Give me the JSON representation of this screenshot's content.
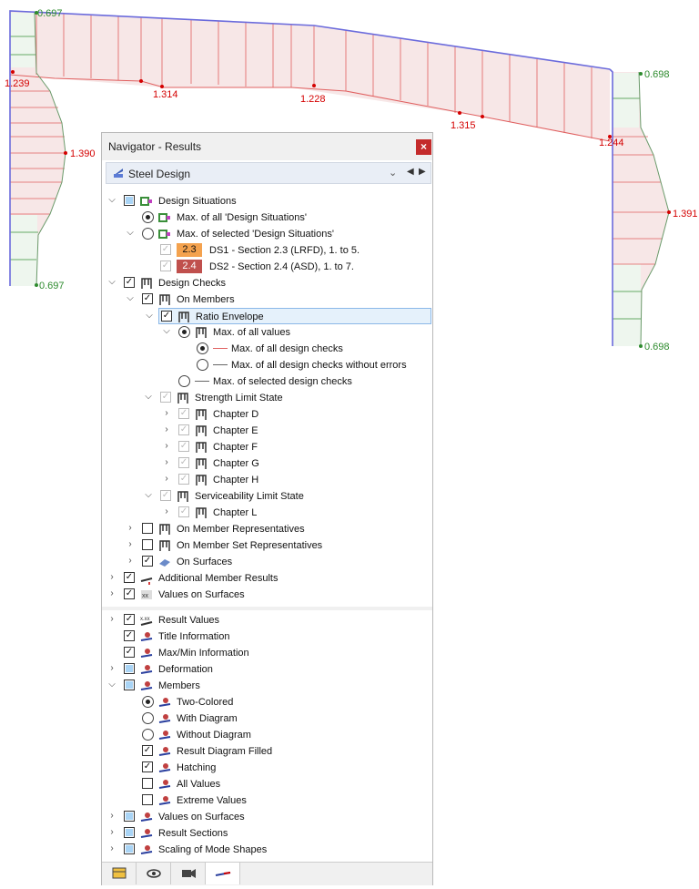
{
  "diagram": {
    "labels": {
      "left_top": "0.697",
      "left_bottom": "0.697",
      "right_top": "0.698",
      "right_bottom": "0.698",
      "v1": "1.239",
      "v2": "1.314",
      "v3": "1.228",
      "v4": "1.315",
      "v5": "1.244",
      "left_max": "1.390",
      "right_max": "1.391"
    },
    "colors": {
      "member": "#6b6bdc",
      "diagram_line": "#e06060",
      "diagram_fill": "#f7e7e7",
      "min_label": "#2e8b2e",
      "max_label": "#d40000"
    }
  },
  "navigator": {
    "title": "Navigator - Results",
    "close_icon": "close-icon",
    "module": "Steel Design",
    "items": [
      {
        "label": "Design Situations"
      },
      {
        "label": "Max. of all 'Design Situations'"
      },
      {
        "label": "Max. of selected 'Design Situations'"
      },
      {
        "badge": "2.3",
        "badge_color": "#f4a24e",
        "label": "DS1 - Section 2.3 (LRFD), 1. to 5."
      },
      {
        "badge": "2.4",
        "badge_color": "#c0504d",
        "label": "DS2 - Section 2.4 (ASD), 1. to 7."
      },
      {
        "label": "Design Checks"
      },
      {
        "label": "On Members"
      },
      {
        "label": "Ratio Envelope"
      },
      {
        "label": "Max. of all values"
      },
      {
        "label": "Max. of all design checks"
      },
      {
        "label": "Max. of all design checks without errors"
      },
      {
        "label": "Max. of selected design checks"
      },
      {
        "label": "Strength Limit State"
      },
      {
        "label": "Chapter D"
      },
      {
        "label": "Chapter E"
      },
      {
        "label": "Chapter F"
      },
      {
        "label": "Chapter G"
      },
      {
        "label": "Chapter H"
      },
      {
        "label": "Serviceability Limit State"
      },
      {
        "label": "Chapter L"
      },
      {
        "label": "On Member Representatives"
      },
      {
        "label": "On Member Set Representatives"
      },
      {
        "label": "On Surfaces"
      },
      {
        "label": "Additional Member Results"
      },
      {
        "label": "Values on Surfaces"
      },
      {
        "label": "Result Values"
      },
      {
        "label": "Title Information"
      },
      {
        "label": "Max/Min Information"
      },
      {
        "label": "Deformation"
      },
      {
        "label": "Members"
      },
      {
        "label": "Two-Colored"
      },
      {
        "label": "With Diagram"
      },
      {
        "label": "Without Diagram"
      },
      {
        "label": "Result Diagram Filled"
      },
      {
        "label": "Hatching"
      },
      {
        "label": "All Values"
      },
      {
        "label": "Extreme Values"
      },
      {
        "label": "Values on Surfaces"
      },
      {
        "label": "Result Sections"
      },
      {
        "label": "Scaling of Mode Shapes"
      }
    ],
    "tabs": [
      "data-tab-icon",
      "eye-icon",
      "camera-icon",
      "results-icon"
    ]
  }
}
